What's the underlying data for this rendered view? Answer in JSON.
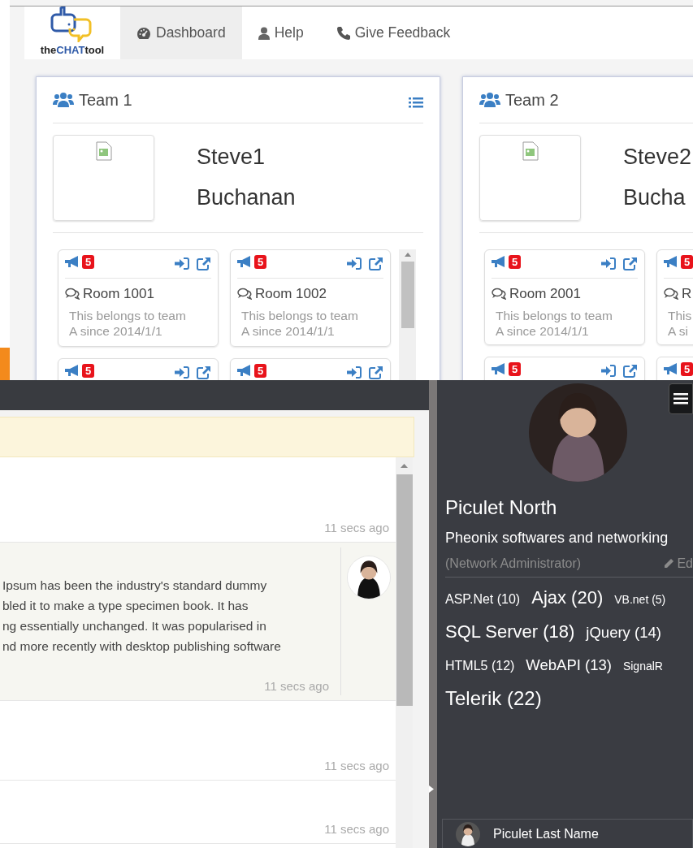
{
  "nav": {
    "logo": [
      {
        "text": "the",
        "highlight": false
      },
      {
        "text": "CHAT",
        "highlight": true
      },
      {
        "text": "tool",
        "highlight": false
      }
    ],
    "items": [
      {
        "label": "Dashboard",
        "selected": true
      },
      {
        "label": "Help",
        "selected": false
      },
      {
        "label": "Give Feedback",
        "selected": false
      }
    ]
  },
  "teams": [
    {
      "title": "Team 1",
      "list_button": true,
      "first_name": "Steve1",
      "last_name": "Buchanan",
      "rooms": [
        {
          "badge": "5",
          "links": true,
          "title": "Room 1001",
          "description_lines": [
            "This belongs to team",
            "A since 2014/1/1"
          ]
        },
        {
          "badge": "5",
          "links": true,
          "title": "Room 1002",
          "description_lines": [
            "This belongs to team",
            "A since 2014/1/1"
          ]
        },
        {
          "badge": "5",
          "links": true
        },
        {
          "badge": "5",
          "links": true
        }
      ]
    },
    {
      "title": "Team 2",
      "list_button": false,
      "first_name": "Steve2",
      "last_name": "Bucha",
      "rooms": [
        {
          "badge": "5",
          "links": true,
          "title": "Room 2001",
          "description_lines": [
            "This belongs to team",
            "A since 2014/1/1"
          ]
        },
        {
          "badge": "5",
          "title": "R",
          "description_lines": [
            "This",
            "A si"
          ]
        },
        {
          "badge": "5",
          "links": true
        },
        {
          "badge": "5"
        }
      ]
    }
  ],
  "chat": {
    "messages": [
      {
        "highlighted": false,
        "time": "11 secs ago"
      },
      {
        "highlighted": true,
        "avatar": true,
        "text_lines": [
          "Ipsum has been the industry's standard dummy",
          "bled it to make a type specimen book. It has",
          "ng essentially unchanged. It was popularised in",
          "nd more recently with desktop publishing software"
        ],
        "time": "11 secs ago"
      },
      {
        "highlighted": false,
        "time": "11 secs ago"
      },
      {
        "highlighted": false,
        "time": "11 secs ago"
      }
    ]
  },
  "profile": {
    "name": "Piculet North",
    "company": "Pheonix softwares and networking",
    "role": "(Network Administrator)",
    "edit_label": "Ed",
    "tags": [
      {
        "label": "ASP.Net (10)",
        "kind": "small"
      },
      {
        "label": "Ajax (20)",
        "kind": "large"
      },
      {
        "label": "VB.net (5)",
        "kind": "tiny"
      },
      {
        "label": "SQL Server (18)",
        "kind": "large"
      },
      {
        "label": "jQuery (14)",
        "kind": "medium"
      },
      {
        "label": "HTML5 (12)",
        "kind": "small"
      },
      {
        "label": "WebAPI (13)",
        "kind": "medium"
      },
      {
        "label": "SignalR",
        "kind": "tiny"
      },
      {
        "label": "Telerik (22)",
        "kind": "xlarge"
      }
    ],
    "contacts": [
      {
        "name": "Piculet Last Name"
      }
    ]
  }
}
